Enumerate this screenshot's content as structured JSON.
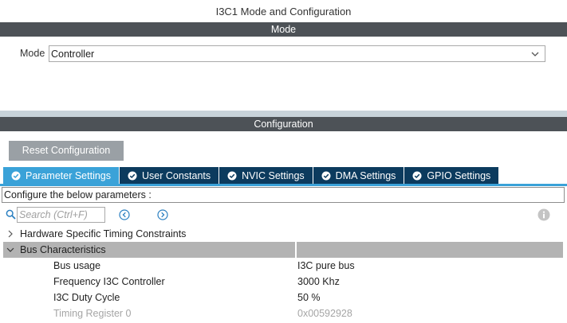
{
  "window": {
    "title": "I3C1 Mode and Configuration"
  },
  "mode_section": {
    "header": "Mode",
    "mode_label": "Mode",
    "mode_value": "Controller"
  },
  "config_section": {
    "header": "Configuration",
    "reset_label": "Reset Configuration",
    "tabs": [
      {
        "label": "Parameter Settings",
        "active": true
      },
      {
        "label": "User Constants",
        "active": false
      },
      {
        "label": "NVIC Settings",
        "active": false
      },
      {
        "label": "DMA Settings",
        "active": false
      },
      {
        "label": "GPIO Settings",
        "active": false
      }
    ],
    "configure_text": "Configure the below parameters :",
    "search": {
      "placeholder": "Search (Ctrl+F)"
    },
    "groups": [
      {
        "label": "Hardware Specific Timing Constraints",
        "expanded": false
      },
      {
        "label": "Bus Characteristics",
        "expanded": true
      }
    ],
    "params": [
      {
        "name": "Bus usage",
        "value": "I3C pure bus",
        "enabled": true
      },
      {
        "name": "Frequency I3C Controller",
        "value": "3000 Khz",
        "enabled": true
      },
      {
        "name": "I3C Duty Cycle",
        "value": "50 %",
        "enabled": true
      },
      {
        "name": "Timing Register 0",
        "value": "0x00592928",
        "enabled": false
      }
    ]
  },
  "colors": {
    "section_bar": "#4d5257",
    "tab_active": "#3aa2d8",
    "tab_inactive": "#0c3b5e",
    "reset_button": "#9aa0a5",
    "group_row": "#b3b3b3"
  }
}
